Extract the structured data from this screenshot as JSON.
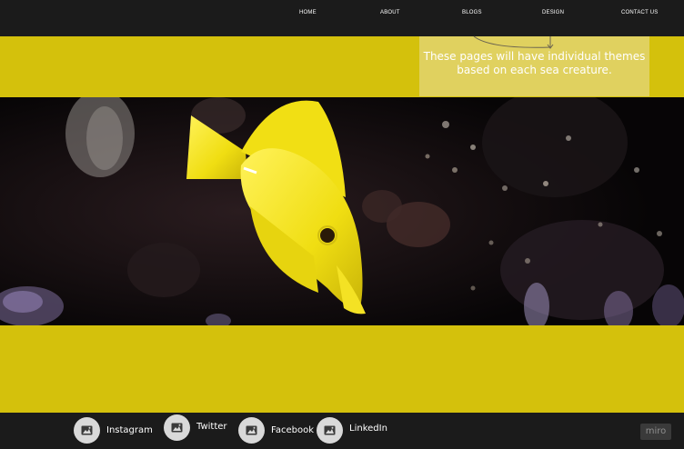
{
  "nav": {
    "items": [
      {
        "label": "HOME"
      },
      {
        "label": "ABOUT"
      },
      {
        "label": "BLOGS"
      },
      {
        "label": "DESIGN"
      },
      {
        "label": "CONTACT US"
      }
    ]
  },
  "annotation": {
    "text": "These pages will have individual themes based on each sea creature."
  },
  "hero": {
    "image": "yellow-tang-fish-photo"
  },
  "social": {
    "items": [
      {
        "label": "Instagram",
        "icon": "image-icon"
      },
      {
        "label": "Twitter",
        "icon": "image-icon"
      },
      {
        "label": "Facebook",
        "icon": "image-icon"
      },
      {
        "label": "LinkedIn",
        "icon": "image-icon"
      }
    ]
  },
  "badge": {
    "label": "miro"
  },
  "colors": {
    "band": "#d4c10c",
    "dark": "#1b1b1b",
    "annotation": "#e0d15f",
    "fish": "#f2e21a"
  }
}
